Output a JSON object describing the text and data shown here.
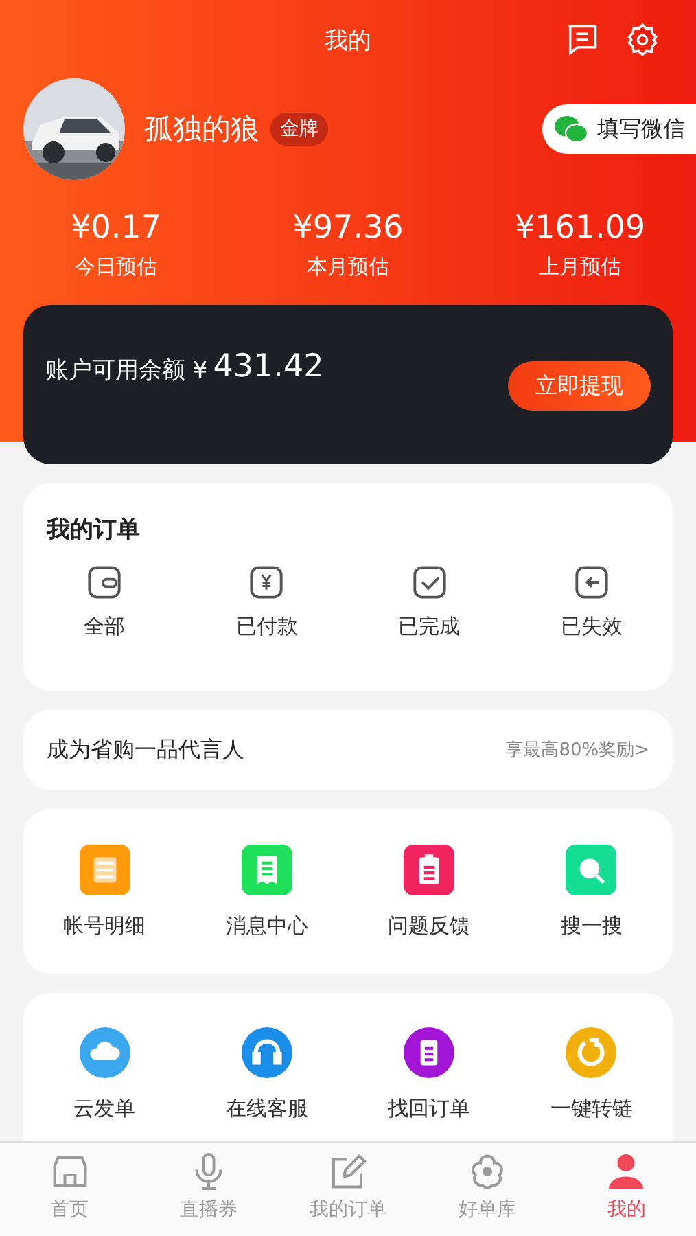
{
  "header": {
    "title": "我的"
  },
  "profile": {
    "name": "孤独的狼",
    "badge": "金牌",
    "wechat_button": "填写微信"
  },
  "stats": [
    {
      "value": "¥0.17",
      "label": "今日预估"
    },
    {
      "value": "¥97.36",
      "label": "本月预估"
    },
    {
      "value": "¥161.09",
      "label": "上月预估"
    }
  ],
  "balance": {
    "label": "账户可用余额",
    "currency": "¥",
    "amount": "431.42",
    "button": "立即提现"
  },
  "orders": {
    "title": "我的订单",
    "items": [
      {
        "kind": "wallet",
        "label": "全部"
      },
      {
        "kind": "paid",
        "label": "已付款"
      },
      {
        "kind": "done",
        "label": "已完成"
      },
      {
        "kind": "expired",
        "label": "已失效"
      }
    ]
  },
  "promo": {
    "text": "成为省购一品代言人",
    "link": "享最高80%奖励>"
  },
  "tools": [
    {
      "kind": "sliders",
      "color": "#ff9a0a",
      "label": "帐号明细"
    },
    {
      "kind": "receipt",
      "color": "#1ee05a",
      "label": "消息中心"
    },
    {
      "kind": "clipboard",
      "color": "#f0245e",
      "label": "问题反馈"
    },
    {
      "kind": "search",
      "color": "#16dd94",
      "label": "搜一搜"
    }
  ],
  "services": [
    {
      "kind": "cloud",
      "color": "#3aa7ee",
      "label": "云发单"
    },
    {
      "kind": "headset",
      "color": "#1a8ee8",
      "label": "在线客服"
    },
    {
      "kind": "note",
      "color": "#a315d6",
      "label": "找回订单"
    },
    {
      "kind": "refresh",
      "color": "#f2b00c",
      "label": "一键转链"
    }
  ],
  "tab_bar": [
    {
      "kind": "home",
      "label": "首页",
      "selected": false
    },
    {
      "kind": "mic",
      "label": "直播券",
      "selected": false
    },
    {
      "kind": "edit",
      "label": "我的订单",
      "selected": false
    },
    {
      "kind": "flower",
      "label": "好单库",
      "selected": false
    },
    {
      "kind": "person",
      "label": "我的",
      "selected": true
    }
  ]
}
